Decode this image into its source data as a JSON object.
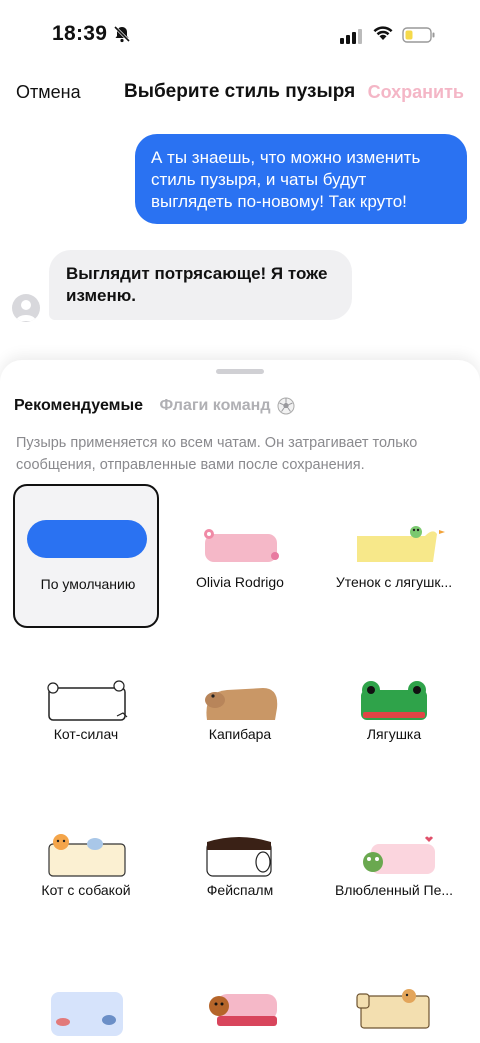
{
  "status": {
    "time": "18:39",
    "battery_color": "#f5d94a"
  },
  "header": {
    "cancel": "Отмена",
    "title": "Выберите стиль пузыря",
    "save": "Сохранить"
  },
  "chat": {
    "outgoing": "А ты знаешь, что можно изменить стиль пузыря, и чаты будут выглядеть по-новому! Так круто!",
    "incoming": "Выглядит потрясающе! Я тоже изменю."
  },
  "sheet": {
    "tabs": [
      {
        "label": "Рекомендуемые",
        "active": true
      },
      {
        "label": "Флаги команд",
        "active": false,
        "icon": "soccer-ball-icon"
      }
    ],
    "note": "Пузырь применяется ко всем чатам. Он затрагивает только сообщения, отправленные вами после сохранения.",
    "styles": [
      {
        "label": "По умолчанию",
        "selected": true
      },
      {
        "label": "Olivia Rodrigo"
      },
      {
        "label": "Утенок с лягушк..."
      },
      {
        "label": "Кот-силач"
      },
      {
        "label": "Капибара"
      },
      {
        "label": "Лягушка"
      },
      {
        "label": "Кот с собакой"
      },
      {
        "label": "Фейспалм"
      },
      {
        "label": "Влюбленный Пе..."
      },
      {
        "label": ""
      },
      {
        "label": ""
      },
      {
        "label": ""
      }
    ]
  },
  "colors": {
    "accent": "#2a72f2",
    "save_disabled": "#f4b6c6"
  }
}
